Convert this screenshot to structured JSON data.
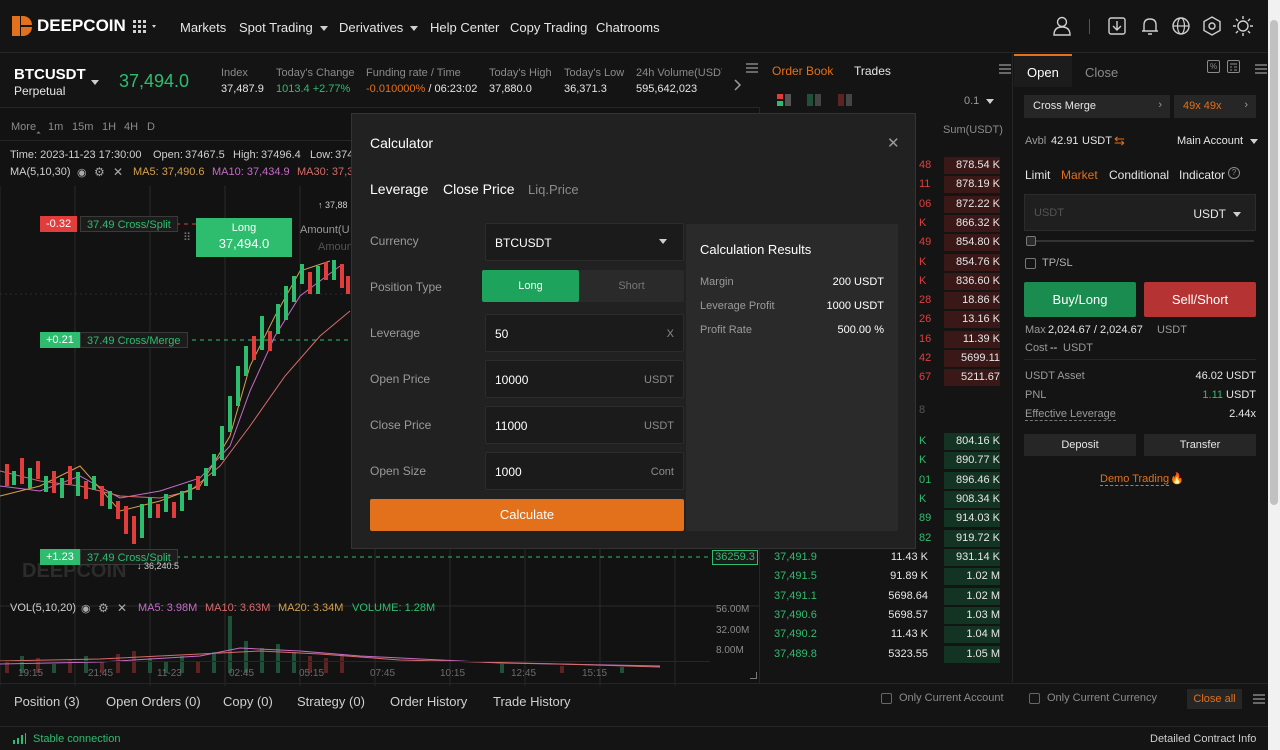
{
  "nav": {
    "brand": "DEEPCOIN",
    "links": [
      "Markets",
      "Spot Trading",
      "Derivatives",
      "Help Center",
      "Copy Trading",
      "Chatrooms"
    ]
  },
  "ticker": {
    "symbol": "BTCUSDT",
    "type": "Perpetual",
    "price": "37,494.0",
    "stats": [
      {
        "label": "Index",
        "value": "37,487.9"
      },
      {
        "label": "Today's Change",
        "value": "1013.4 +2.77%"
      },
      {
        "label": "Funding rate / Time",
        "value_rate": "-0.010000%",
        "value_time": "/ 06:23:02"
      },
      {
        "label": "Today's High",
        "value": "37,880.0"
      },
      {
        "label": "Today's Low",
        "value": "36,371.3"
      },
      {
        "label": "24h Volume(USDT",
        "value": "595,642,023"
      }
    ]
  },
  "chart": {
    "timeframes": [
      "More",
      "1m",
      "15m",
      "1H",
      "4H",
      "D"
    ],
    "active_timeframe": "15m",
    "ohlc": {
      "time": "Time: 2023-11-23 17:30:00",
      "open_label": "Open:",
      "open": "37467.5",
      "high_label": "High:",
      "high": "37496.4",
      "low_label": "Low:",
      "low": "374"
    },
    "ma": {
      "label": "MA(5,10,30)",
      "ma5": "MA5: 37,490.6",
      "ma10": "MA10: 37,434.9",
      "ma30": "MA30: 37,3"
    },
    "position_tags": [
      {
        "pnl": "-0.32",
        "label": "37.49 Cross/Split"
      },
      {
        "pnl": "+0.21",
        "label": "37.49 Cross/Merge"
      },
      {
        "pnl": "+1.23",
        "label": "37.49 Cross/Split"
      }
    ],
    "long_tag": {
      "label": "Long",
      "price": "37,494.0"
    },
    "amount_label": "Amount(U",
    "amount_label2": "Amount",
    "high_mark": "37,88",
    "low_mark": "36,240.5",
    "price_axis_tag": "36259.3",
    "watermark": "DEEPCOIN",
    "vol": {
      "label": "VOL(5,10,20)",
      "ma5": "MA5: 3.98M",
      "ma10": "MA10: 3.63M",
      "ma20": "MA20: 3.34M",
      "volume": "VOLUME: 1.28M"
    },
    "vol_axis": [
      "56.00M",
      "32.00M",
      "8.00M"
    ],
    "time_axis": [
      "19:15",
      "21:45",
      "11-23",
      "02:45",
      "05:15",
      "07:45",
      "10:15",
      "12:45",
      "15:15"
    ]
  },
  "orderbook": {
    "tabs": [
      "Order Book",
      "Trades"
    ],
    "precision": "0.1",
    "sum_header": "Sum(USDT)",
    "mid_digit": "8",
    "asks": [
      {
        "price": "48",
        "sum": "878.54 K"
      },
      {
        "price": "11",
        "sum": "878.19 K"
      },
      {
        "price": "06",
        "sum": "872.22 K"
      },
      {
        "price": "K",
        "sum": "866.32 K"
      },
      {
        "price": "49",
        "sum": "854.80 K"
      },
      {
        "price": "K",
        "sum": "854.76 K"
      },
      {
        "price": "K",
        "sum": "836.60 K"
      },
      {
        "price": "28",
        "sum": "18.86 K"
      },
      {
        "price": "26",
        "sum": "13.16 K"
      },
      {
        "price": "16",
        "sum": "11.39 K"
      },
      {
        "price": "42",
        "sum": "5699.11"
      },
      {
        "price": "67",
        "sum": "5211.67"
      }
    ],
    "bids_partial": [
      {
        "price": "K",
        "sum": "804.16 K"
      },
      {
        "price": "K",
        "sum": "890.77 K"
      },
      {
        "price": "01",
        "sum": "896.46 K"
      },
      {
        "price": "K",
        "sum": "908.34 K"
      },
      {
        "price": "89",
        "sum": "914.03 K"
      },
      {
        "price": "82",
        "sum": "919.72 K"
      }
    ],
    "bids": [
      {
        "price": "37,491.9",
        "amount": "11.43 K",
        "sum": "931.14 K"
      },
      {
        "price": "37,491.5",
        "amount": "91.89 K",
        "sum": "1.02 M"
      },
      {
        "price": "37,491.1",
        "amount": "5698.64",
        "sum": "1.02 M"
      },
      {
        "price": "37,490.6",
        "amount": "5698.57",
        "sum": "1.03 M"
      },
      {
        "price": "37,490.2",
        "amount": "11.43 K",
        "sum": "1.04 M"
      },
      {
        "price": "37,489.8",
        "amount": "5323.55",
        "sum": "1.05 M"
      }
    ]
  },
  "trade": {
    "tabs": [
      "Open",
      "Close"
    ],
    "margin_mode": "Cross Merge",
    "leverage": "49x 49x",
    "avbl_label": "Avbl",
    "avbl_value": "42.91",
    "avbl_unit": "USDT",
    "account": "Main Account",
    "order_types": [
      "Limit",
      "Market",
      "Conditional",
      "Indicator"
    ],
    "active_order_type": "Market",
    "amount_placeholder": "USDT",
    "amount_unit": "USDT",
    "tpsl": "TP/SL",
    "buy": "Buy/Long",
    "sell": "Sell/Short",
    "max_label": "Max",
    "max_value": "2,024.67 / 2,024.67",
    "max_unit": "USDT",
    "cost_label": "Cost",
    "cost_value": "--",
    "cost_unit": "USDT",
    "asset_label": "USDT Asset",
    "asset_value": "46.02 USDT",
    "pnl_label": "PNL",
    "pnl_value": "1.11",
    "pnl_unit": "USDT",
    "eff_label": "Effective Leverage",
    "eff_value": "2.44x",
    "deposit": "Deposit",
    "transfer": "Transfer",
    "demo": "Demo Trading"
  },
  "bottom": {
    "tabs": [
      "Position (3)",
      "Open Orders (0)",
      "Copy (0)",
      "Strategy (0)",
      "Order History",
      "Trade History"
    ],
    "only_account": "Only Current Account",
    "only_currency": "Only Current Currency",
    "close_all": "Close all",
    "status": "Stable connection",
    "detail": "Detailed Contract Info"
  },
  "modal": {
    "title": "Calculator",
    "tabs": [
      "Leverage",
      "Close Price",
      "Liq.Price"
    ],
    "fields": {
      "currency_label": "Currency",
      "currency_value": "BTCUSDT",
      "position_label": "Position Type",
      "long": "Long",
      "short": "Short",
      "leverage_label": "Leverage",
      "leverage_value": "50",
      "leverage_clear": "X",
      "open_price_label": "Open Price",
      "open_price_value": "10000",
      "open_price_unit": "USDT",
      "close_price_label": "Close Price",
      "close_price_value": "11000",
      "close_price_unit": "USDT",
      "open_size_label": "Open Size",
      "open_size_value": "1000",
      "open_size_unit": "Cont"
    },
    "calculate": "Calculate",
    "results": {
      "title": "Calculation Results",
      "rows": [
        {
          "label": "Margin",
          "value": "200 USDT"
        },
        {
          "label": "Leverage Profit",
          "value": "1000 USDT"
        },
        {
          "label": "Profit Rate",
          "value": "500.00 %"
        }
      ]
    }
  },
  "colors": {
    "accent": "#e3701a",
    "up": "#2ebd6e",
    "down": "#e23d3d",
    "bg": "#141414"
  }
}
